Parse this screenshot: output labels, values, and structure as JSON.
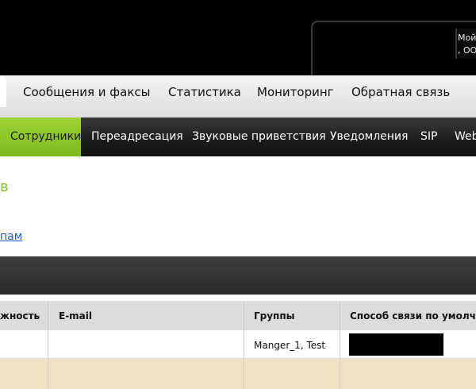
{
  "header": {
    "account_line1": "Мой",
    "account_line2": ", ОО"
  },
  "main_nav": {
    "items": [
      {
        "label": "Сообщения и факсы"
      },
      {
        "label": "Статистика"
      },
      {
        "label": "Мониторинг"
      },
      {
        "label": "Обратная связь"
      }
    ]
  },
  "sub_nav": {
    "active": "Сотрудники",
    "items": [
      {
        "label": "Переадресация"
      },
      {
        "label": "Звуковые приветствия"
      },
      {
        "label": "Уведомления"
      },
      {
        "label": "SIP"
      },
      {
        "label": "Web"
      }
    ]
  },
  "content": {
    "green_fragment": "в",
    "link_fragment": "пам"
  },
  "table": {
    "columns": [
      {
        "label": "жность"
      },
      {
        "label": "E-mail"
      },
      {
        "label": "Группы"
      },
      {
        "label": "Способ связи по умолчан"
      }
    ],
    "rows": [
      {
        "position": "",
        "email": "",
        "groups": "Manger_1, Test",
        "contact": ""
      },
      {
        "position": "",
        "email": "",
        "groups": "",
        "contact": ""
      }
    ]
  },
  "colors": {
    "accent_green": "#8cc63f",
    "link_blue": "#1a5ccf",
    "row_highlight": "#efe5c6"
  }
}
